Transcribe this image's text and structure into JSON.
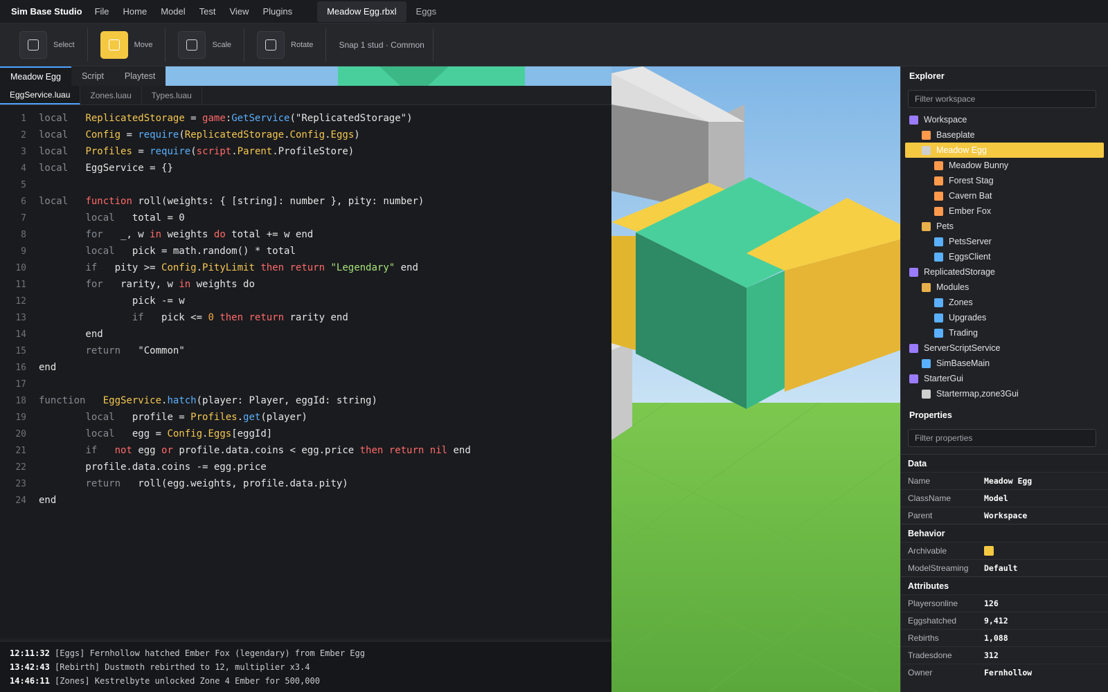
{
  "menubar": {
    "brand": "Sim Base Studio",
    "menus": [
      "File",
      "Home",
      "Model",
      "Test",
      "View",
      "Plugins"
    ],
    "file_tab": "Meadow Egg.rbxl",
    "second_tab": "Eggs"
  },
  "toolbar": {
    "tools": [
      {
        "label": "Select",
        "active": false
      },
      {
        "label": "Move",
        "active": true
      },
      {
        "label": "Scale",
        "active": false
      },
      {
        "label": "Rotate",
        "active": false
      }
    ],
    "snap": "Snap 1 stud · Common"
  },
  "doc_tabs": [
    "Meadow Egg",
    "Script",
    "Playtest"
  ],
  "file_tabs": [
    "EggService.luau",
    "Zones.luau",
    "Types.luau"
  ],
  "code_lines": [
    "1",
    "2",
    "3",
    "4",
    "5",
    "6",
    "7",
    "8",
    "9",
    "10",
    "11",
    "12",
    "13",
    "14",
    "15",
    "16",
    "17",
    "18",
    "19",
    "20",
    "21",
    "22",
    "23",
    "24"
  ],
  "console": [
    {
      "time": "12:11:32",
      "text": " [Eggs] Fernhollow hatched Ember Fox (legendary) from Ember Egg"
    },
    {
      "time": "13:42:43",
      "text": " [Rebirth] Dustmoth rebirthed to 12, multiplier x3.4"
    },
    {
      "time": "14:46:11",
      "text": " [Zones] Kestrelbyte unlocked Zone 4 Ember for 500,000"
    }
  ],
  "explorer": {
    "title": "Explorer",
    "filter_placeholder": "Filter workspace",
    "items": [
      {
        "label": "Workspace",
        "depth": 0,
        "color": "#9b7bff"
      },
      {
        "label": "Baseplate",
        "depth": 1,
        "color": "#ff9a4d"
      },
      {
        "label": "Meadow Egg",
        "depth": 1,
        "color": "#cfcfcf",
        "selected": true
      },
      {
        "label": "Meadow Bunny",
        "depth": 2,
        "color": "#ff9a4d"
      },
      {
        "label": "Forest Stag",
        "depth": 2,
        "color": "#ff9a4d"
      },
      {
        "label": "Cavern Bat",
        "depth": 2,
        "color": "#ff9a4d"
      },
      {
        "label": "Ember Fox",
        "depth": 2,
        "color": "#ff9a4d"
      },
      {
        "label": "Pets",
        "depth": 1,
        "color": "#e8b04a"
      },
      {
        "label": "PetsServer",
        "depth": 2,
        "color": "#5ab0ff"
      },
      {
        "label": "EggsClient",
        "depth": 2,
        "color": "#5ab0ff"
      },
      {
        "label": "ReplicatedStorage",
        "depth": 0,
        "color": "#9b7bff"
      },
      {
        "label": "Modules",
        "depth": 1,
        "color": "#e8b04a"
      },
      {
        "label": "Zones",
        "depth": 2,
        "color": "#5ab0ff"
      },
      {
        "label": "Upgrades",
        "depth": 2,
        "color": "#5ab0ff"
      },
      {
        "label": "Trading",
        "depth": 2,
        "color": "#5ab0ff"
      },
      {
        "label": "ServerScriptService",
        "depth": 0,
        "color": "#9b7bff"
      },
      {
        "label": "SimBaseMain",
        "depth": 1,
        "color": "#5ab0ff"
      },
      {
        "label": "StarterGui",
        "depth": 0,
        "color": "#9b7bff"
      },
      {
        "label": "Startermap,zone3Gui",
        "depth": 1,
        "color": "#cfcfcf"
      }
    ]
  },
  "properties": {
    "title": "Properties",
    "filter_placeholder": "Filter properties",
    "sections": [
      {
        "name": "Data",
        "rows": [
          {
            "key": "Name",
            "value": "Meadow Egg"
          },
          {
            "key": "ClassName",
            "value": "Model"
          },
          {
            "key": "Parent",
            "value": "Workspace"
          }
        ]
      },
      {
        "name": "Behavior",
        "rows": [
          {
            "key": "Archivable",
            "value": "",
            "checkbox": true
          },
          {
            "key": "ModelStreaming",
            "value": "Default"
          }
        ]
      },
      {
        "name": "Attributes",
        "rows": [
          {
            "key": "Playersonline",
            "value": "126"
          },
          {
            "key": "Eggshatched",
            "value": "9,412"
          },
          {
            "key": "Rebirths",
            "value": "1,088"
          },
          {
            "key": "Tradesdone",
            "value": "312"
          },
          {
            "key": "Owner",
            "value": "Fernhollow"
          }
        ]
      }
    ]
  },
  "colors": {
    "accent": "#f5c842",
    "tab_accent": "#4da3ff",
    "grass": "#6dbd4a",
    "sky": "#8fc0ec"
  }
}
